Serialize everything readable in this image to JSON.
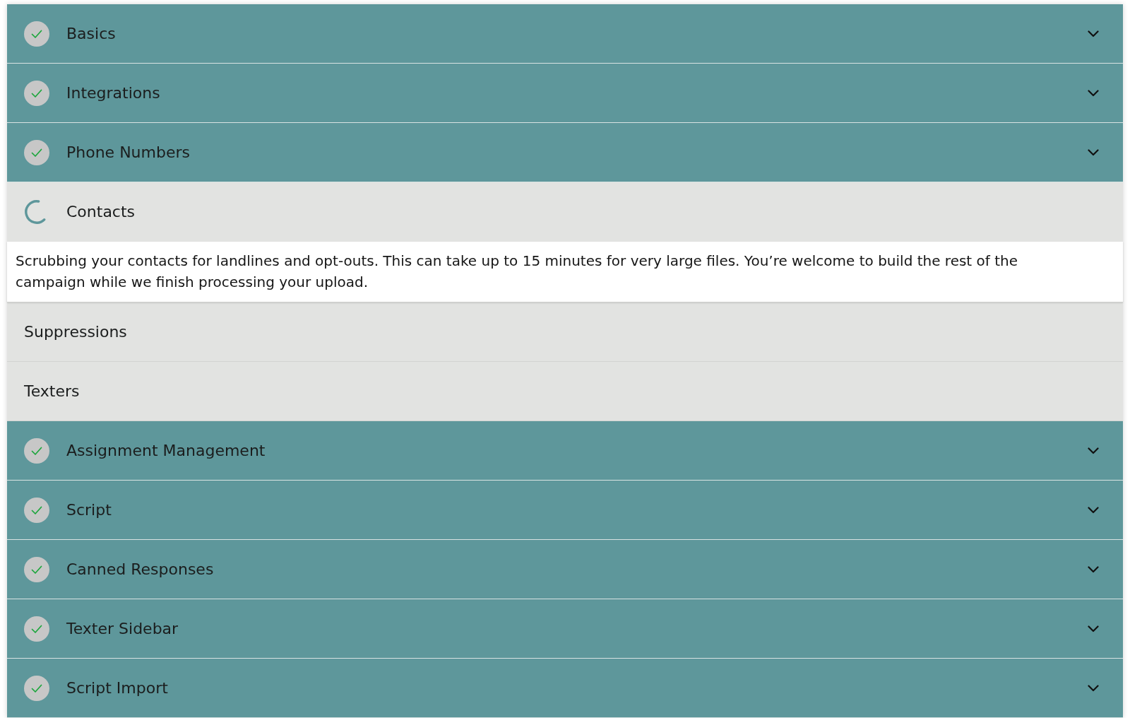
{
  "sections": [
    {
      "title": "Basics",
      "kind": "complete"
    },
    {
      "title": "Integrations",
      "kind": "complete"
    },
    {
      "title": "Phone Numbers",
      "kind": "complete"
    },
    {
      "title": "Contacts",
      "kind": "loading",
      "description": "Scrubbing your contacts for landlines and opt-outs. This can take up to 15 minutes for very large files. You’re welcome to build the rest of the campaign while we finish processing your upload."
    },
    {
      "title": "Suppressions",
      "kind": "pending"
    },
    {
      "title": "Texters",
      "kind": "pending"
    },
    {
      "title": "Assignment Management",
      "kind": "complete"
    },
    {
      "title": "Script",
      "kind": "complete"
    },
    {
      "title": "Canned Responses",
      "kind": "complete"
    },
    {
      "title": "Texter Sidebar",
      "kind": "complete"
    },
    {
      "title": "Script Import",
      "kind": "complete"
    }
  ]
}
